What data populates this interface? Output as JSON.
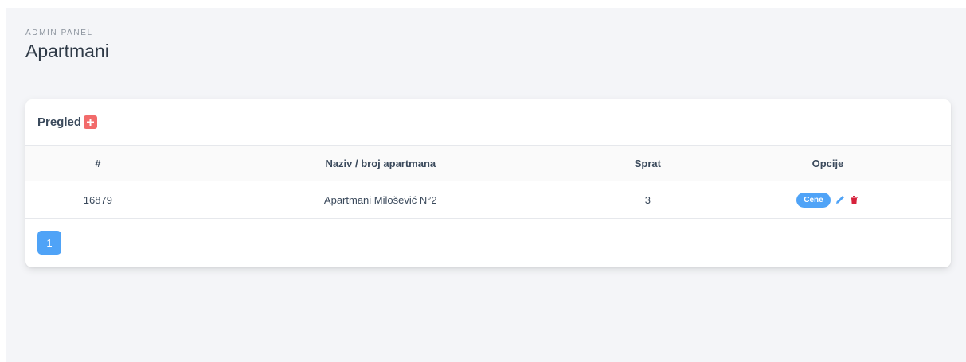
{
  "header": {
    "eyebrow": "ADMIN PANEL",
    "title": "Apartmani"
  },
  "card": {
    "title": "Pregled",
    "add_icon": "plus-icon"
  },
  "table": {
    "columns": [
      "#",
      "Naziv / broj apartmana",
      "Sprat",
      "Opcije"
    ],
    "rows": [
      {
        "id": "16879",
        "name": "Apartmani Milošević N°2",
        "floor": "3",
        "prices_label": "Cene",
        "edit_icon": "pencil-icon",
        "delete_icon": "trash-icon"
      }
    ]
  },
  "pagination": {
    "current": "1"
  },
  "colors": {
    "accent": "#4fa3f7",
    "danger": "#d6213b",
    "add": "#f26b6b",
    "background": "#f4f5f8"
  }
}
